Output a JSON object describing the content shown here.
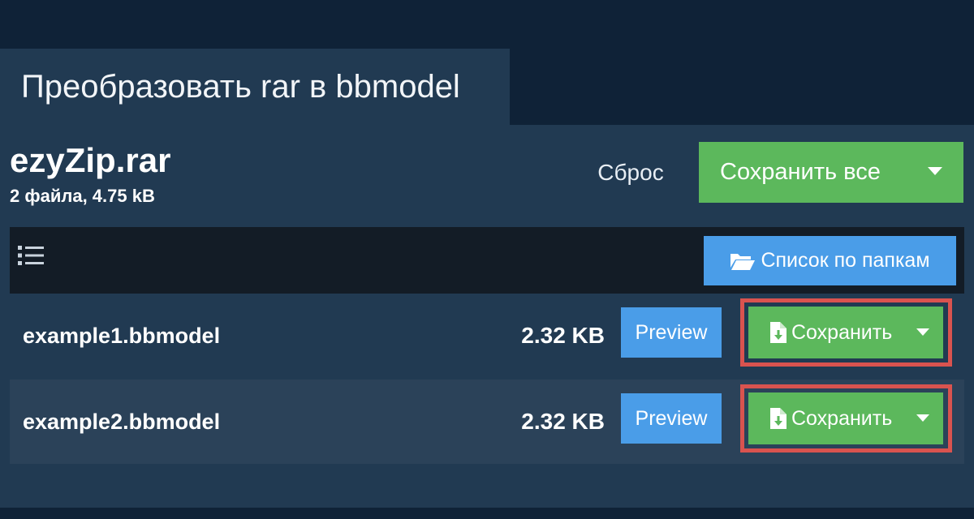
{
  "tab": {
    "title": "Преобразовать rar в bbmodel"
  },
  "archive": {
    "name": "ezyZip.rar",
    "summary": "2 файла, 4.75 kB"
  },
  "actions": {
    "reset_label": "Сброс",
    "save_all_label": "Сохранить все"
  },
  "toolbar": {
    "list_icon": "list-icon",
    "folder_view_label": "Список по папкам",
    "folder_icon": "folder-open-icon"
  },
  "files": [
    {
      "name": "example1.bbmodel",
      "size": "2.32 KB",
      "preview_label": "Preview",
      "save_label": "Сохранить",
      "save_icon": "file-download-icon",
      "highlighted": true
    },
    {
      "name": "example2.bbmodel",
      "size": "2.32 KB",
      "preview_label": "Preview",
      "save_label": "Сохранить",
      "save_icon": "file-download-icon",
      "highlighted": true
    }
  ],
  "colors": {
    "background": "#0f2237",
    "panel": "#213a52",
    "row_alt": "#2b4259",
    "toolbar": "#131c26",
    "green": "#5cb85c",
    "blue": "#4a9de8",
    "highlight": "#d9534f"
  }
}
